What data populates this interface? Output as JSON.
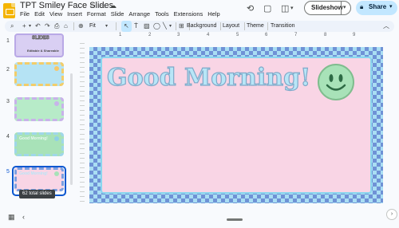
{
  "app": {
    "title": "TPT Smiley Face Slides",
    "menu": [
      "File",
      "Edit",
      "View",
      "Insert",
      "Format",
      "Slide",
      "Arrange",
      "Tools",
      "Extensions",
      "Help"
    ]
  },
  "header": {
    "slideshow_label": "Slideshow",
    "share_label": "Share",
    "icons": [
      "history-icon",
      "chat-icon",
      "camera-icon"
    ],
    "share_icon": "lock-icon"
  },
  "toolbar": {
    "zoom_label": "Fit",
    "background_label": "Background",
    "layout_label": "Layout",
    "theme_label": "Theme",
    "transition_label": "Transition"
  },
  "ruler": {
    "ticks": [
      "1",
      "2",
      "3",
      "4",
      "5",
      "6",
      "7",
      "8",
      "9"
    ]
  },
  "filmstrip": {
    "tooltip": "62 total slides",
    "slides": [
      {
        "number": "1",
        "text": "SLIDES",
        "sub": "Editable & Shareable",
        "color": "#c7b9ea"
      },
      {
        "number": "2",
        "text": "",
        "color": "#b5e3f4",
        "border": "#f2cd6a"
      },
      {
        "number": "3",
        "text": "",
        "color": "#b7ebc8",
        "border": "#c8b2ea"
      },
      {
        "number": "4",
        "text": "Good Morning!",
        "color": "#a8e2b8",
        "border": "#9fd7e9"
      },
      {
        "number": "5",
        "text": "Good Morning!",
        "color": "#f9d5e5",
        "border": "#8fd0e6",
        "selected": true
      }
    ]
  },
  "slide": {
    "title": "Good Morning!",
    "colors": {
      "bg": "#f9d5e5",
      "check_dark": "#6f92d6",
      "check_light": "#a9def3",
      "smiley": "#a8e2b8"
    }
  }
}
